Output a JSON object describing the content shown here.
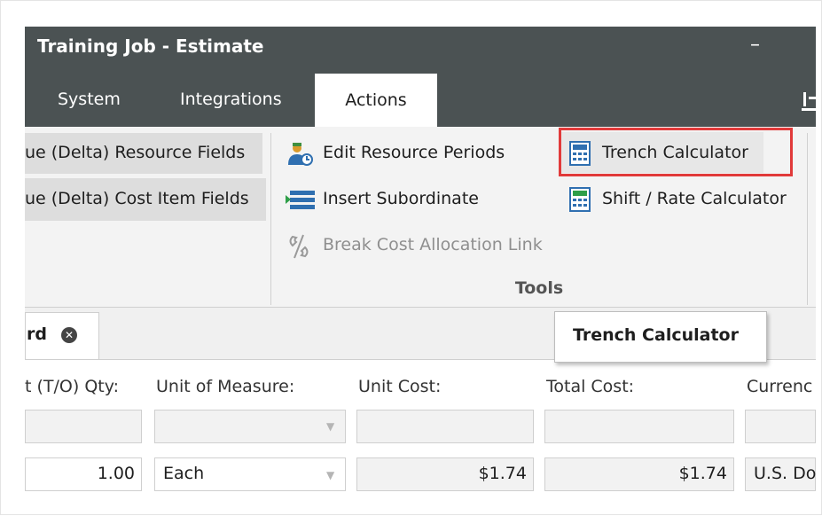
{
  "window": {
    "title": "Training Job - Estimate",
    "minimize_glyph": "–"
  },
  "tabs": [
    {
      "label": "System"
    },
    {
      "label": "Integrations"
    },
    {
      "label": "Actions"
    }
  ],
  "ribbon": {
    "left_items": [
      {
        "label": "ue (Delta) Resource Fields"
      },
      {
        "label": "ue (Delta) Cost Item Fields"
      }
    ],
    "middle_items": [
      {
        "label": "Edit Resource Periods",
        "icon": "person-clock-icon"
      },
      {
        "label": "Insert Subordinate",
        "icon": "insert-rows-icon"
      },
      {
        "label": "Break Cost Allocation Link",
        "icon": "broken-link-icon",
        "disabled": true
      }
    ],
    "right_items": [
      {
        "label": "Trench Calculator",
        "icon": "calculator-icon",
        "highlighted": true
      },
      {
        "label": "Shift / Rate Calculator",
        "icon": "calculator-icon"
      }
    ],
    "group_label": "Tools"
  },
  "tooltip": {
    "text": "Trench Calculator"
  },
  "document_tab": {
    "label": "rd",
    "close_glyph": "✕"
  },
  "grid": {
    "headers": [
      "t (T/O) Qty:",
      "Unit of Measure:",
      "Unit Cost:",
      "Total Cost:",
      "Currenc"
    ],
    "row2": {
      "qty": "1.00",
      "uom": "Each",
      "unit_cost": "$1.74",
      "total_cost": "$1.74",
      "currency": "U.S. Do"
    }
  },
  "colors": {
    "titlebar": "#4b5253",
    "highlight_border": "#e13a3a",
    "ribbon_bg": "#f3f3f3"
  }
}
